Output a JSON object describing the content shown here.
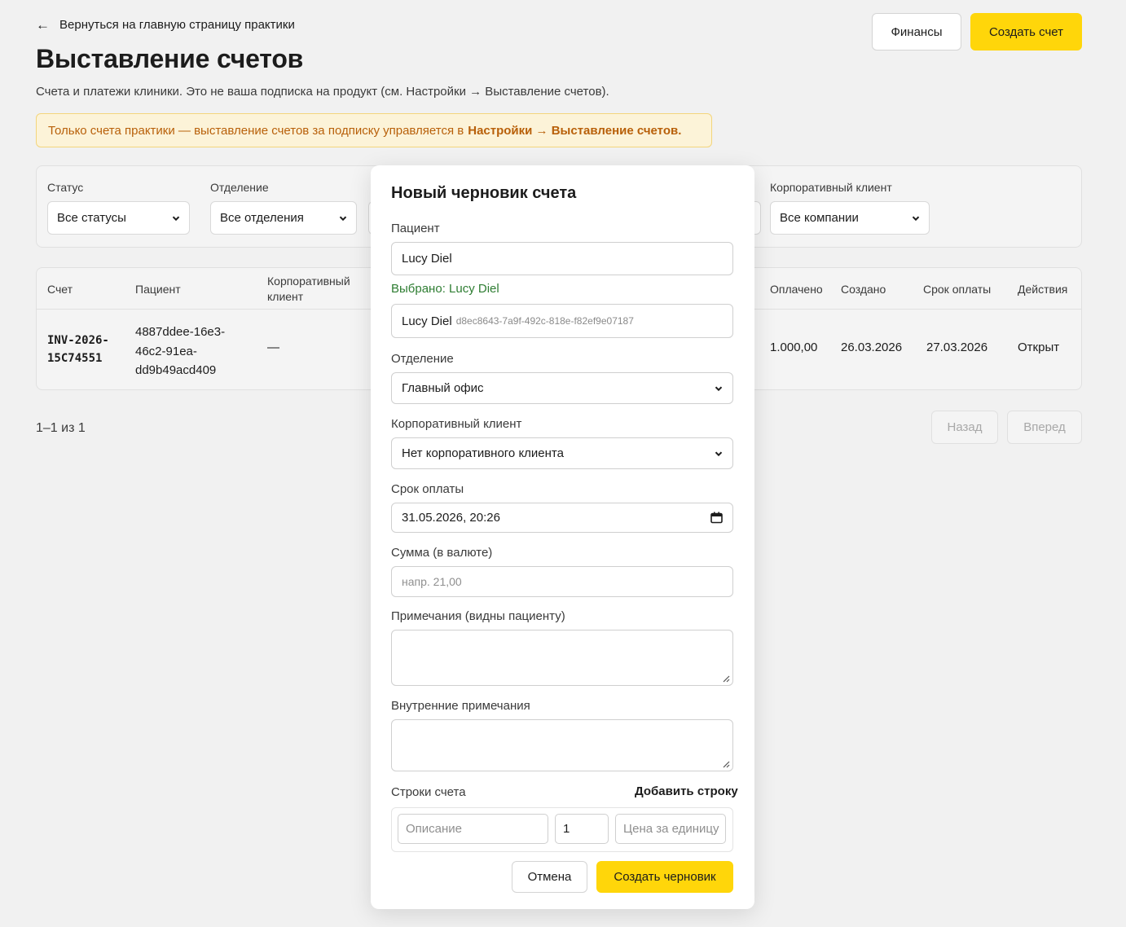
{
  "header": {
    "back_link": "Вернуться на главную страницу практики",
    "title": "Выставление счетов",
    "subtitle": "Счета и платежи клиники. Это не ваша подписка на продукт (см. Настройки → Выставление счетов).",
    "warning_text": "Только счета практики — выставление счетов за подписку управляется в",
    "warning_link": "Настройки → Выставление счетов.",
    "finance_button": "Финансы",
    "create_button": "Создать счет"
  },
  "filters": {
    "status_label": "Статус",
    "status_value": "Все статусы",
    "department_label": "Отделение",
    "department_value": "Все отделения",
    "corporate_label": "Корпоративный клиент",
    "corporate_value": "Все компании"
  },
  "table": {
    "columns": {
      "invoice": "Счет",
      "patient": "Пациент",
      "corporate_line1": "Корпоративный",
      "corporate_line2": "клиент",
      "paid": "Оплачено",
      "created": "Создано",
      "due": "Срок оплаты",
      "actions": "Действия"
    },
    "rows": [
      {
        "invoice_line1": "INV-2026-",
        "invoice_line2": "15C74551",
        "patient_line1": "4887ddee-16e3-",
        "patient_line2": "46c2-91ea-",
        "patient_line3": "dd9b49acd409",
        "corporate": "—",
        "paid": "1.000,00",
        "created": "26.03.2026",
        "due": "27.03.2026",
        "action": "Открыт"
      }
    ]
  },
  "pagination": {
    "info": "1–1 из 1",
    "prev": "Назад",
    "next": "Вперед"
  },
  "modal": {
    "title": "Новый черновик счета",
    "patient_label": "Пациент",
    "patient_value": "Lucy Diel",
    "selected_text": "Выбрано: Lucy Diel",
    "patient_option_name": "Lucy Diel",
    "patient_option_id": "d8ec8643-7a9f-492c-818e-f82ef9e07187",
    "department_label": "Отделение",
    "department_value": "Главный офис",
    "corporate_label": "Корпоративный клиент",
    "corporate_value": "Нет корпоративного клиента",
    "due_label": "Срок оплаты",
    "due_value": "31.05.2026, 20:26",
    "amount_label": "Сумма (в валюте)",
    "amount_placeholder": "напр. 21,00",
    "notes_label": "Примечания (видны пациенту)",
    "internal_notes_label": "Внутренние примечания",
    "lines_label": "Строки счета",
    "add_line": "Добавить строку",
    "line_description_placeholder": "Описание",
    "line_quantity": "1",
    "line_price_placeholder": "Цена за единицу",
    "cancel_button": "Отмена",
    "submit_button": "Создать черновик"
  },
  "colors": {
    "accent": "#ffd60a",
    "warning_bg": "#fcf3d8",
    "warning_text": "#b8600a",
    "success": "#2e7d32"
  }
}
